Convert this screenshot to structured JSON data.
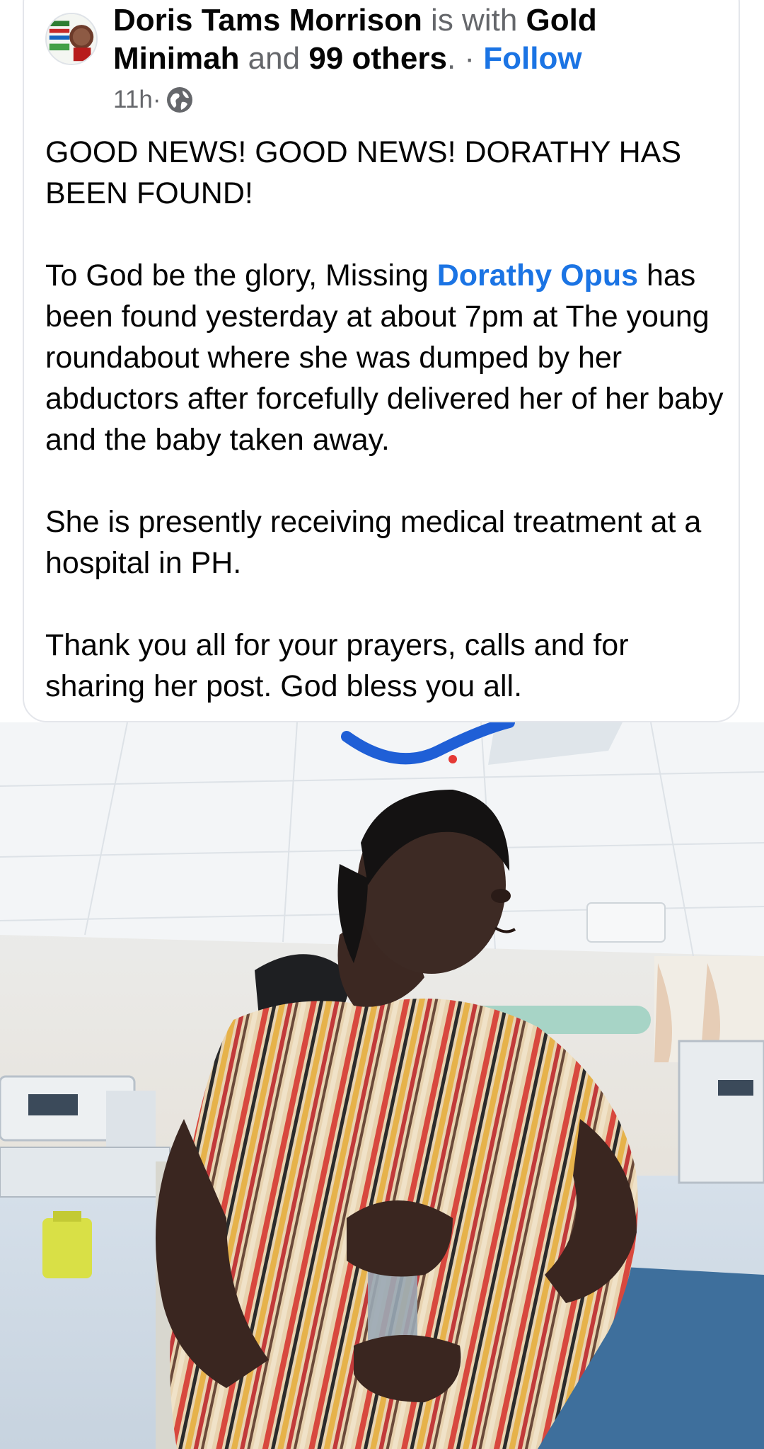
{
  "post": {
    "author": "Doris Tams Morrison",
    "with_text": " is with ",
    "tagged_first": "Gold Minimah",
    "and_text": " and ",
    "tagged_others": "99 others",
    "dot_sep": ". · ",
    "follow_label": "Follow",
    "time": "11h",
    "time_sep": " ·",
    "privacy_icon": "globe-icon",
    "body": {
      "p1_line": "GOOD NEWS! GOOD NEWS! DORATHY HAS BEEN FOUND!",
      "p2_before": "To God be the glory, Missing ",
      "p2_mention": "Dorathy Opus",
      "p2_after": " has been found yesterday at about 7pm at The young roundabout where she was dumped by her abductors after forcefully delivered her of her baby and the baby taken away.",
      "p3": "She is presently receiving medical treatment at a hospital in PH.",
      "p4": "Thank you all for your prayers, calls and for sharing her post. God bless you all."
    }
  },
  "colors": {
    "text": "#050505",
    "secondary": "#65676b",
    "link": "#1b74e4",
    "card_border": "#e4e6eb"
  }
}
